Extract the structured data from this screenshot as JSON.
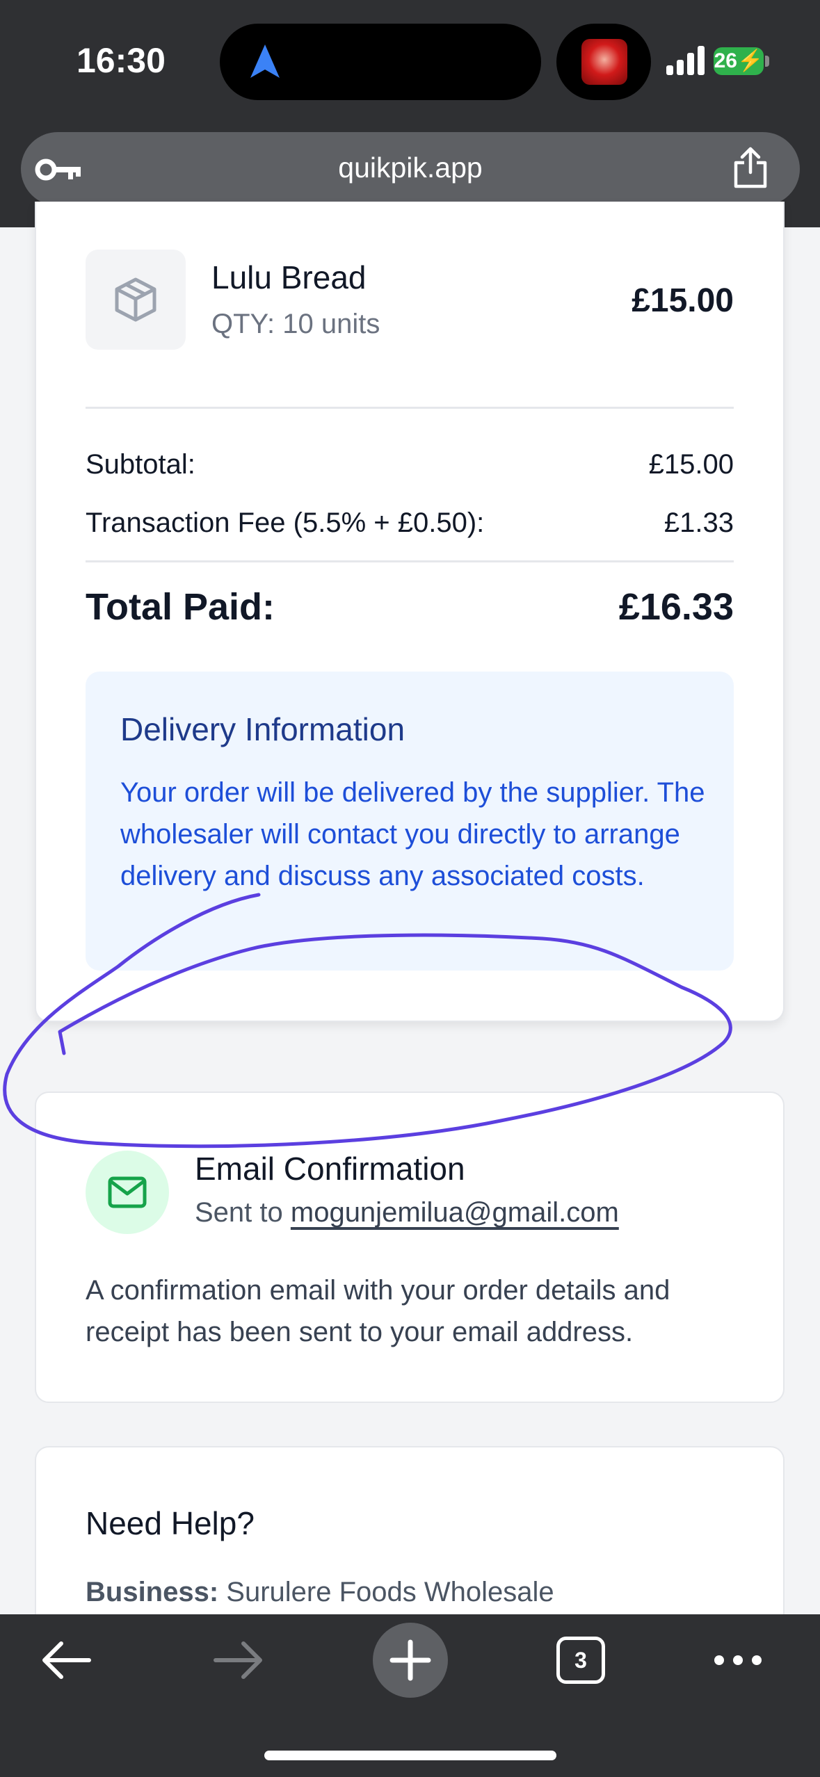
{
  "status_bar": {
    "time": "16:30",
    "battery": "26",
    "icons": [
      "location-arrow-icon",
      "now-playing-artwork",
      "cellular-signal-icon",
      "battery-charging-icon"
    ]
  },
  "browser": {
    "url": "quikpik.app",
    "tab_count": "3",
    "icons": [
      "key-icon",
      "share-icon",
      "back-icon",
      "forward-icon",
      "new-tab-plus-icon",
      "tabs-icon",
      "more-icon"
    ]
  },
  "order": {
    "item": {
      "name": "Lulu Bread",
      "qty": "QTY: 10 units",
      "price": "£15.00",
      "icon": "package-icon"
    },
    "subtotal_label": "Subtotal:",
    "subtotal_value": "£15.00",
    "fee_label": "Transaction Fee (5.5% + £0.50):",
    "fee_value": "£1.33",
    "total_label": "Total Paid:",
    "total_value": "£16.33"
  },
  "delivery": {
    "title": "Delivery Information",
    "body": "Your order will be delivered by the supplier. The wholesaler will contact you directly to arrange delivery and discuss any associated costs."
  },
  "email": {
    "title": "Email Confirmation",
    "sent_prefix": "Sent to ",
    "address": "mogunjemilua@gmail.com",
    "body": "A confirmation email with your order details and receipt has been sent to your email address.",
    "icon": "mail-icon"
  },
  "help": {
    "title": "Need Help?",
    "business_label": "Business:",
    "business_value": " Surulere Foods Wholesale"
  },
  "colors": {
    "annotation_stroke": "#5b3fe0",
    "delivery_bg": "#eff6ff",
    "delivery_text": "#1d4ed8",
    "mail_circle": "#dcfce7",
    "mail_icon": "#16a34a",
    "battery": "#2fb14c"
  }
}
